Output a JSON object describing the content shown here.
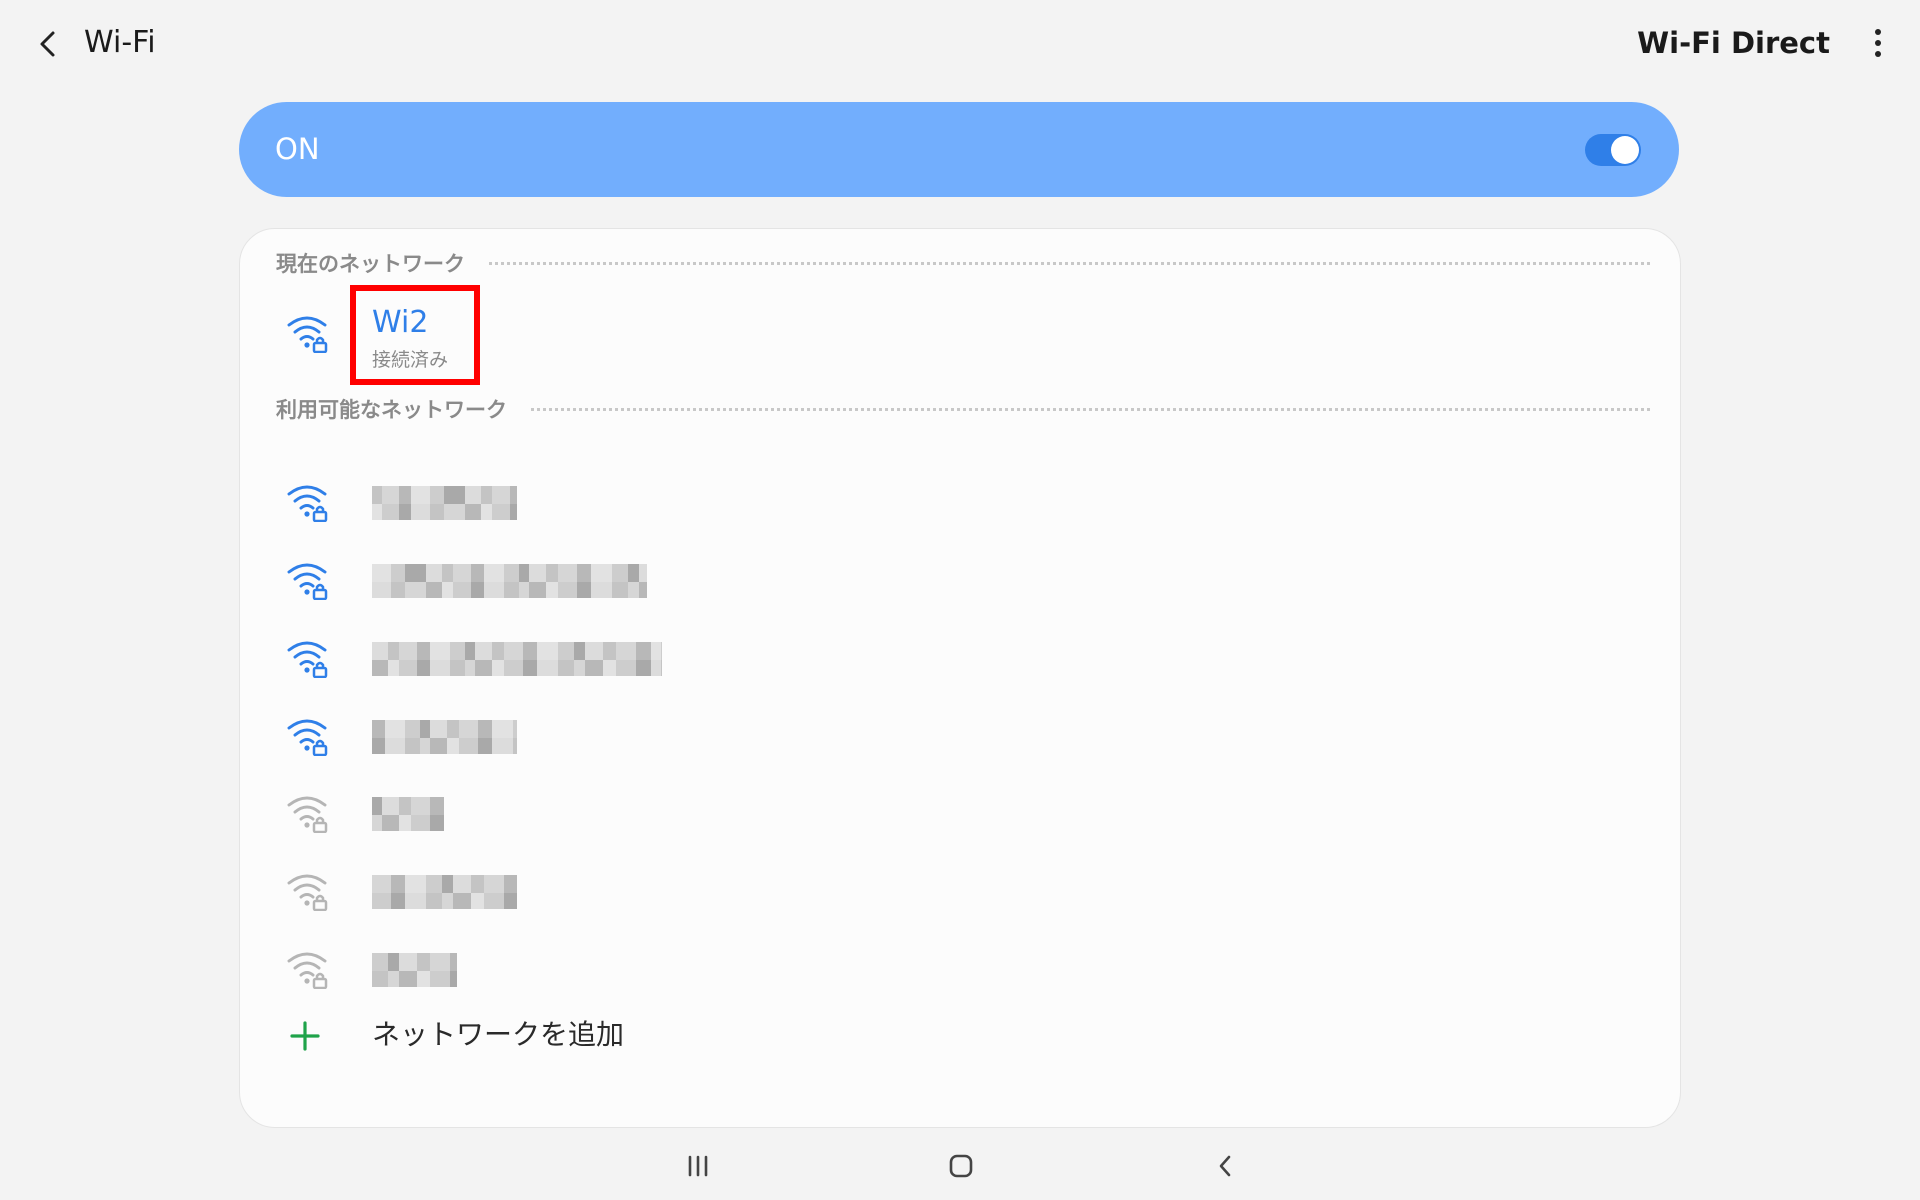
{
  "header": {
    "title": "Wi-Fi",
    "wifi_direct_label": "Wi-Fi Direct",
    "back_icon": "chevron-left-icon",
    "more_icon": "more-vertical-icon"
  },
  "master_switch": {
    "label": "ON",
    "state": true
  },
  "current_network": {
    "section_title": "現在のネットワーク",
    "name": "Wi2",
    "status": "接続済み",
    "icon": "wifi-secured-icon"
  },
  "available_networks": {
    "section_title": "利用可能なネットワーク",
    "note": "network names are pixelated/obscured in the screenshot",
    "items": [
      {
        "signal": "strong",
        "secured": true
      },
      {
        "signal": "strong",
        "secured": true
      },
      {
        "signal": "strong",
        "secured": true
      },
      {
        "signal": "strong",
        "secured": true
      },
      {
        "signal": "weak",
        "secured": true
      },
      {
        "signal": "weak",
        "secured": true
      },
      {
        "signal": "weak",
        "secured": true
      }
    ]
  },
  "add_network": {
    "label": "ネットワークを追加",
    "icon": "plus-icon"
  },
  "navbar": {
    "recents_icon": "recents-icon",
    "home_icon": "home-icon",
    "back_icon": "back-nav-icon"
  },
  "colors": {
    "accent": "#2f7fe8",
    "banner": "#72aefd",
    "highlight": "#ff0000",
    "add_icon": "#1fa34a",
    "weak_signal": "#b5b5b5"
  }
}
